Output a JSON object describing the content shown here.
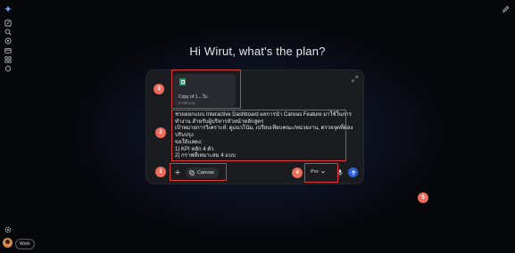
{
  "greeting": "Hi Wirut, what's the plan?",
  "attachment": {
    "name": "Copy of 1....ใบ",
    "sub": "การทำงาน",
    "icon": "google-sheets-icon"
  },
  "prompt_lines": [
    "ช่วยออกแบบ Interactive Dashboard ผลการนำ Canvas Feature มาใช้ในการ",
    "ทำงาน สำหรับผู้บริหารหัวหน้าหลักสูตร",
    "เป้าหมายการวิเคราะห์: ดูแนวโน้ม, เปรียบเทียบคณะ/หน่วยงาน, ตรวจจุดที่ต้อง",
    "ปรับปรุง",
    "ขอให้แสดง:",
    "1) KPI หลัก 4 ตัว",
    "2) กราฟที่เหมาะสม 4 แบบ"
  ],
  "toolbar": {
    "canvas_label": "Canvas",
    "model_label": "Pro"
  },
  "account": {
    "badge": "Work"
  },
  "callouts": [
    "1",
    "2",
    "3",
    "4",
    "5"
  ],
  "colors": {
    "highlight": "#e23b3b",
    "callout": "#ec6b5a",
    "send": "#2c63d6",
    "sheets": "#1ea362"
  }
}
